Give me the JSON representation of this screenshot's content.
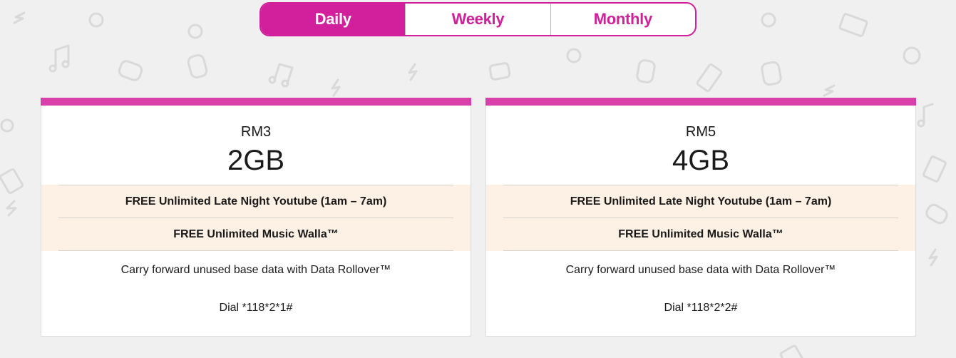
{
  "tabs": [
    {
      "label": "Daily",
      "active": true
    },
    {
      "label": "Weekly",
      "active": false
    },
    {
      "label": "Monthly",
      "active": false
    }
  ],
  "plans": [
    {
      "price": "RM3",
      "data": "2GB",
      "features": [
        "FREE Unlimited Late Night Youtube (1am – 7am)",
        "FREE Unlimited Music Walla™"
      ],
      "rollover": "Carry forward unused base data with Data Rollover™",
      "dial": "Dial *118*2*1#"
    },
    {
      "price": "RM5",
      "data": "4GB",
      "features": [
        "FREE Unlimited Late Night Youtube (1am – 7am)",
        "FREE Unlimited Music Walla™"
      ],
      "rollover": "Carry forward unused base data with Data Rollover™",
      "dial": "Dial *118*2*2#"
    }
  ],
  "colors": {
    "accent": "#d21f9b",
    "card_bar": "#d83fa8",
    "feature_bg": "#fdf0e4",
    "page_bg": "#f0f0f0"
  }
}
